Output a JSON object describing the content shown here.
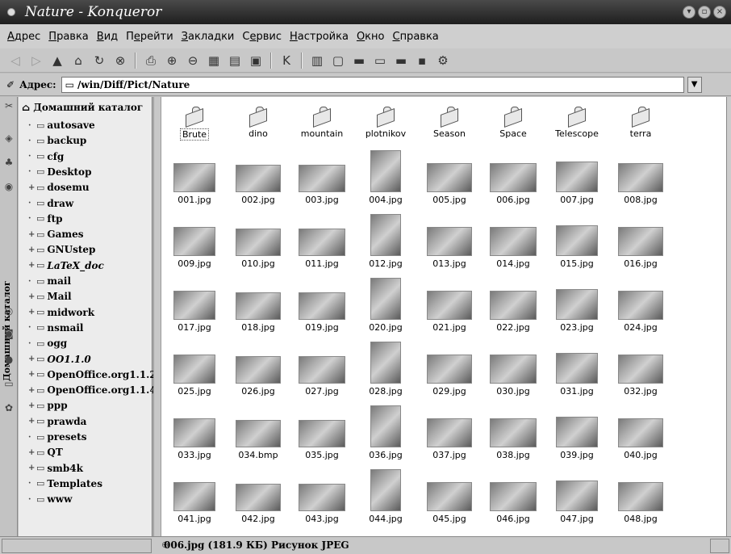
{
  "window": {
    "title": "Nature - Konqueror"
  },
  "menu": [
    {
      "pre": "",
      "u": "А",
      "post": "дрес"
    },
    {
      "pre": "",
      "u": "П",
      "post": "равка"
    },
    {
      "pre": "",
      "u": "В",
      "post": "ид"
    },
    {
      "pre": "П",
      "u": "е",
      "post": "рейти"
    },
    {
      "pre": "",
      "u": "З",
      "post": "акладки"
    },
    {
      "pre": "С",
      "u": "е",
      "post": "рвис"
    },
    {
      "pre": "",
      "u": "Н",
      "post": "астройка"
    },
    {
      "pre": "",
      "u": "О",
      "post": "кно"
    },
    {
      "pre": "",
      "u": "С",
      "post": "правка"
    }
  ],
  "address": {
    "label": "Адрес:",
    "value": "/win/Diff/Pict/Nature"
  },
  "sidebar": {
    "vertical_label": "Домашний каталог",
    "root": "Домашний каталог",
    "items": [
      {
        "label": "autosave",
        "exp": false
      },
      {
        "label": "backup",
        "exp": false
      },
      {
        "label": "cfg",
        "exp": false
      },
      {
        "label": "Desktop",
        "exp": false
      },
      {
        "label": "dosemu",
        "exp": true
      },
      {
        "label": "draw",
        "exp": false
      },
      {
        "label": "ftp",
        "exp": false
      },
      {
        "label": "Games",
        "exp": true
      },
      {
        "label": "GNUstep",
        "exp": true
      },
      {
        "label": "LaTeX_doc",
        "exp": true,
        "italic": true
      },
      {
        "label": "mail",
        "exp": false
      },
      {
        "label": "Mail",
        "exp": true
      },
      {
        "label": "midwork",
        "exp": true
      },
      {
        "label": "nsmail",
        "exp": false
      },
      {
        "label": "ogg",
        "exp": false
      },
      {
        "label": "OO1.1.0",
        "exp": true,
        "italic": true
      },
      {
        "label": "OpenOffice.org1.1.2",
        "exp": true
      },
      {
        "label": "OpenOffice.org1.1.4",
        "exp": true
      },
      {
        "label": "ppp",
        "exp": true
      },
      {
        "label": "prawda",
        "exp": true
      },
      {
        "label": "presets",
        "exp": false
      },
      {
        "label": "QT",
        "exp": true
      },
      {
        "label": "smb4k",
        "exp": true
      },
      {
        "label": "Templates",
        "exp": false
      },
      {
        "label": "www",
        "exp": false
      }
    ]
  },
  "folders": [
    "Brute",
    "dino",
    "mountain",
    "plotnikov",
    "Season",
    "Space",
    "Telescope",
    "terra"
  ],
  "files": [
    "001.jpg",
    "002.jpg",
    "003.jpg",
    "004.jpg",
    "005.jpg",
    "006.jpg",
    "007.jpg",
    "008.jpg",
    "009.jpg",
    "010.jpg",
    "011.jpg",
    "012.jpg",
    "013.jpg",
    "014.jpg",
    "015.jpg",
    "016.jpg",
    "017.jpg",
    "018.jpg",
    "019.jpg",
    "020.jpg",
    "021.jpg",
    "022.jpg",
    "023.jpg",
    "024.jpg",
    "025.jpg",
    "026.jpg",
    "027.jpg",
    "028.jpg",
    "029.jpg",
    "030.jpg",
    "031.jpg",
    "032.jpg",
    "033.jpg",
    "034.bmp",
    "035.jpg",
    "036.jpg",
    "037.jpg",
    "038.jpg",
    "039.jpg",
    "040.jpg",
    "041.jpg",
    "042.jpg",
    "043.jpg",
    "044.jpg",
    "045.jpg",
    "046.jpg",
    "047.jpg",
    "048.jpg"
  ],
  "status": {
    "text": "006.jpg (181.9 КБ)  Рисунок JPEG"
  }
}
